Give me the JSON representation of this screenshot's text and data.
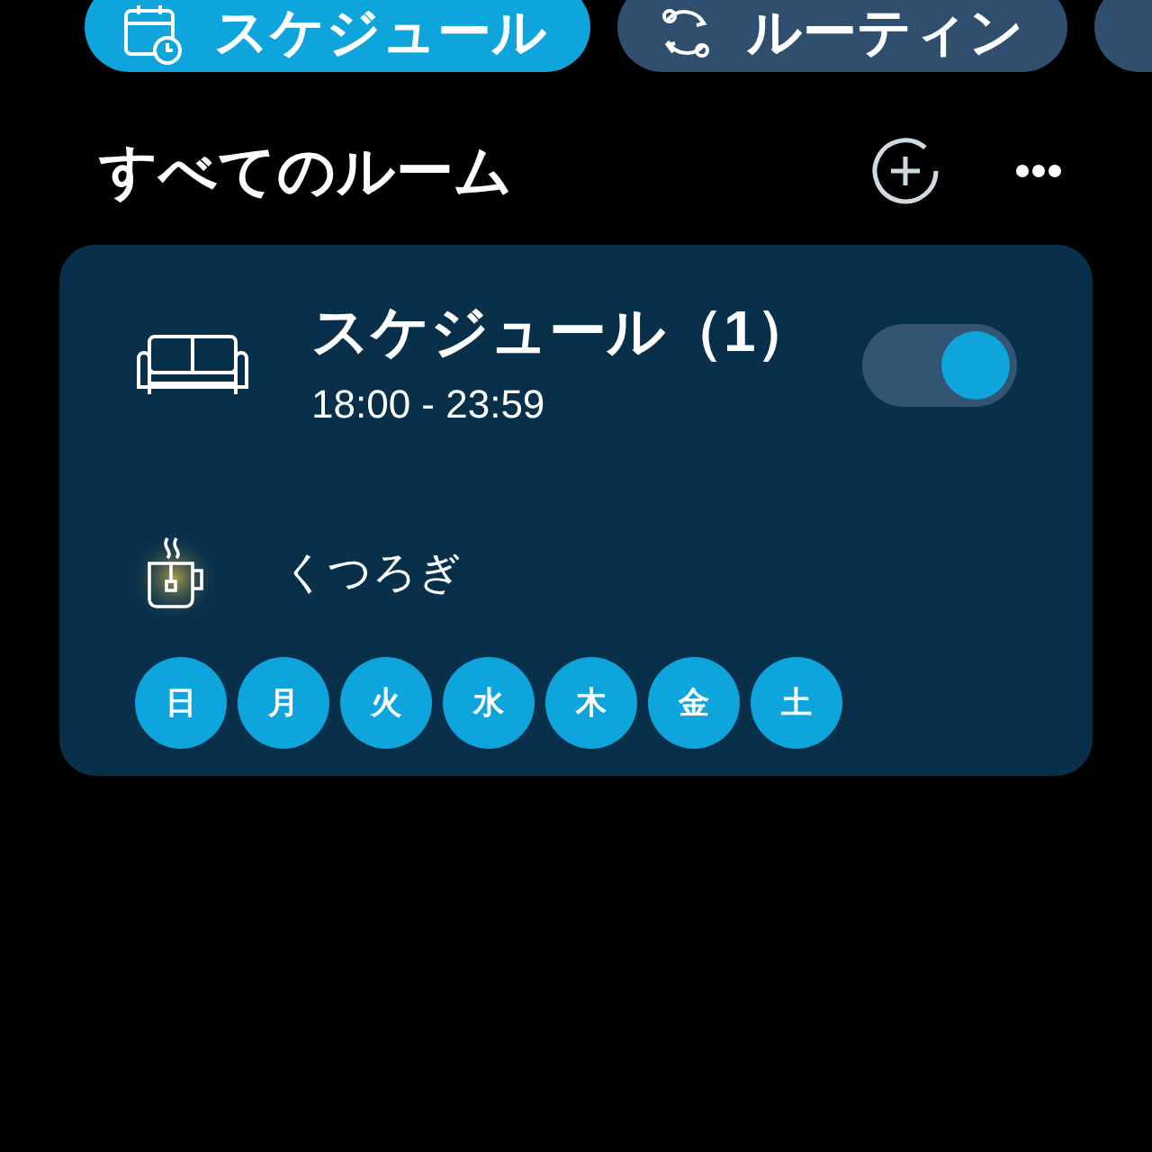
{
  "tabs": [
    {
      "label": "スケジュール",
      "kind": "schedule",
      "selected": true
    },
    {
      "label": "ルーティン",
      "kind": "routine",
      "selected": false
    },
    {
      "selected": false
    }
  ],
  "section": {
    "title": "すべてのルーム"
  },
  "card": {
    "title": "スケジュール（1）",
    "time": "18:00 - 23:59",
    "on": true,
    "scene": "くつろぎ",
    "days": [
      {
        "label": "日",
        "selected": true
      },
      {
        "label": "月",
        "selected": true
      },
      {
        "label": "火",
        "selected": true
      },
      {
        "label": "水",
        "selected": true
      },
      {
        "label": "木",
        "selected": true
      },
      {
        "label": "金",
        "selected": true
      },
      {
        "label": "土",
        "selected": true
      }
    ]
  }
}
